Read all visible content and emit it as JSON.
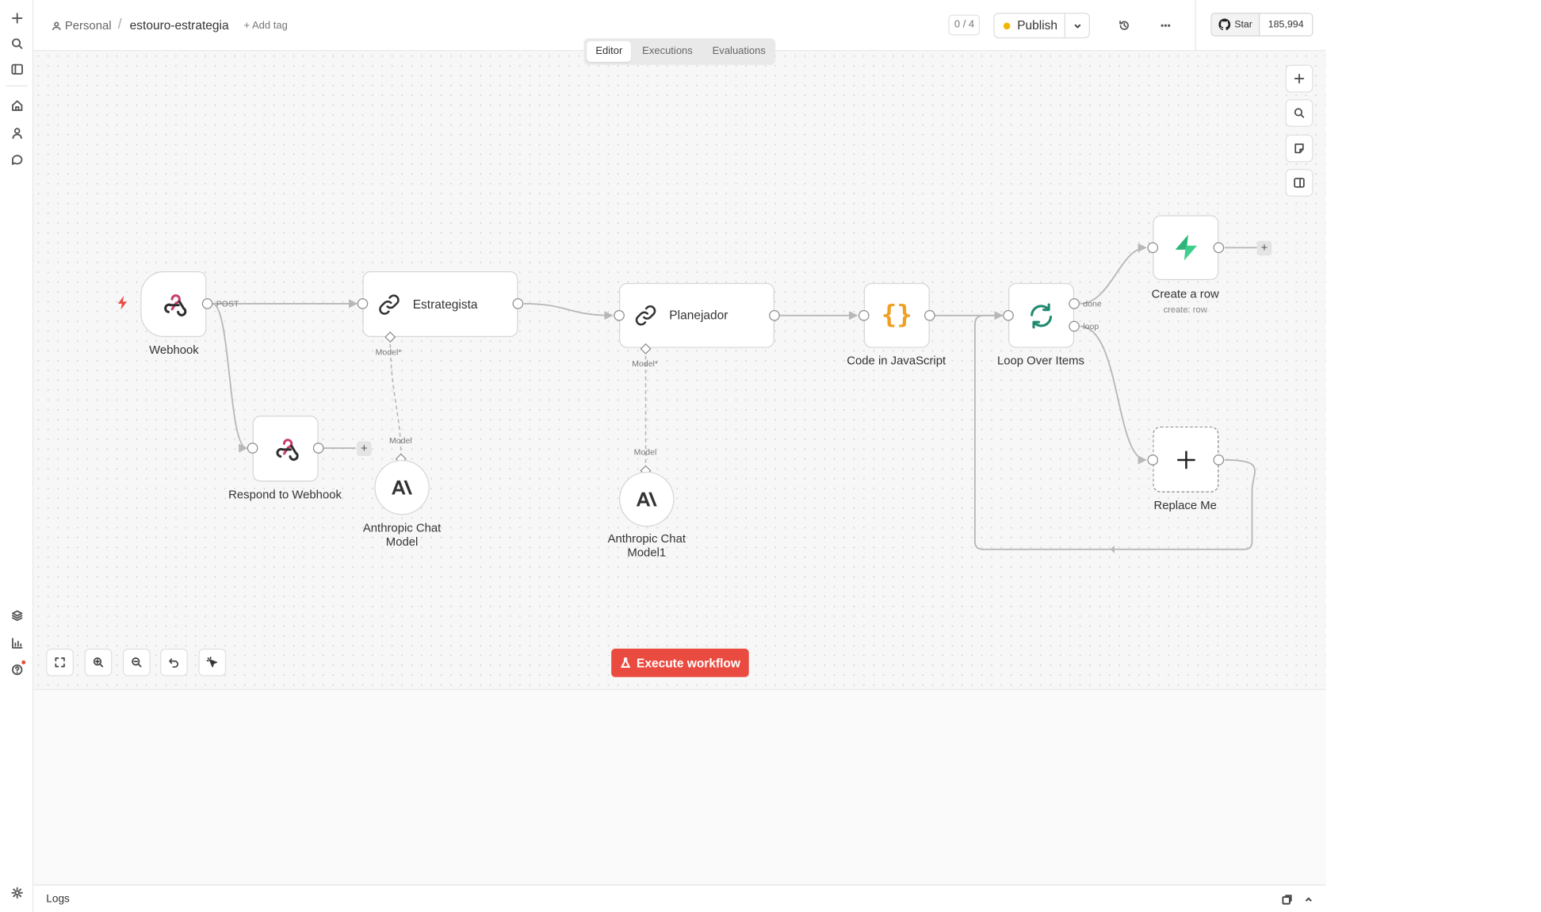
{
  "header": {
    "breadcrumb_personal": "Personal",
    "breadcrumb_sep": "/",
    "workflow_name": "estouro-estrategia",
    "add_tag": "+ Add tag",
    "counter": "0 / 4",
    "publish_label": "Publish",
    "github_star": "Star",
    "github_count": "185,994"
  },
  "tabs": [
    "Editor",
    "Executions",
    "Evaluations"
  ],
  "nodes": {
    "webhook": {
      "label": "Webhook",
      "port_label": "POST"
    },
    "respond": {
      "label": "Respond to Webhook"
    },
    "estrategista": {
      "label": "Estrategista",
      "model_port": "Model*"
    },
    "planejador": {
      "label": "Planejador",
      "model_port": "Model*"
    },
    "anthropic1": {
      "label": "Anthropic Chat\nModel",
      "port_label": "Model"
    },
    "anthropic2": {
      "label": "Anthropic Chat\nModel1",
      "port_label": "Model"
    },
    "code": {
      "label": "Code in JavaScript"
    },
    "loop": {
      "label": "Loop Over Items",
      "done": "done",
      "loop": "loop"
    },
    "create_row": {
      "label": "Create a row",
      "sub": "create: row"
    },
    "replace": {
      "label": "Replace Me"
    }
  },
  "execute_label": "Execute workflow",
  "logs_label": "Logs",
  "colors": {
    "accent": "#ea4b40",
    "publish_dot": "#f2b705",
    "code_icon": "#f0a020",
    "loop_icon": "#1f8a70",
    "supabase": "#3ecf8e"
  }
}
